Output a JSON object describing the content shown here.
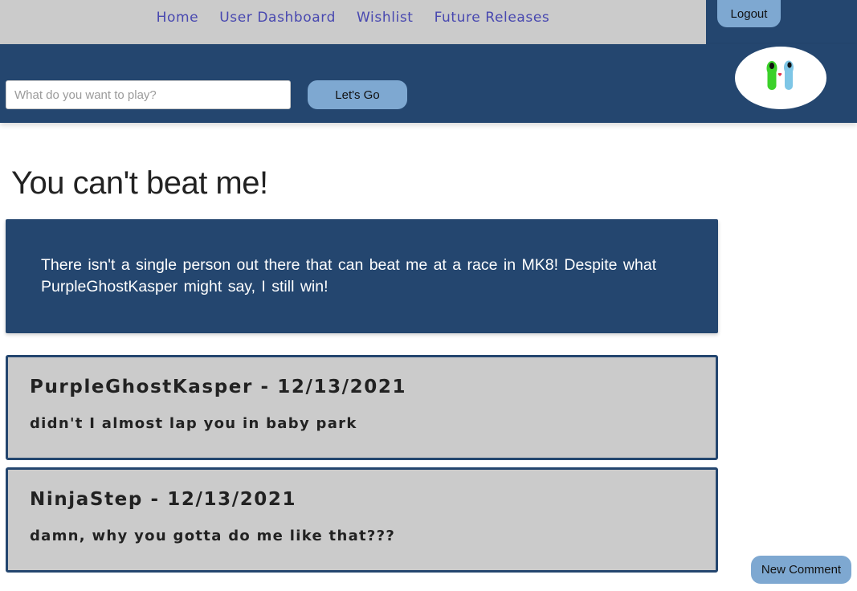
{
  "nav": {
    "items": [
      {
        "label": "Home"
      },
      {
        "label": "User Dashboard"
      },
      {
        "label": "Wishlist"
      },
      {
        "label": "Future Releases"
      }
    ],
    "logout_label": "Logout"
  },
  "search": {
    "placeholder": "What do you want to play?",
    "value": "",
    "button_label": "Let's Go"
  },
  "post": {
    "title": "You can't beat me!",
    "body": "There isn't a single person out there that can beat me at a race in MK8! Despite what PurpleGhostKasper might say, I still win!"
  },
  "comments": [
    {
      "header": "PurpleGhostKasper - 12/13/2021",
      "text": "didn't I almost lap you in baby park"
    },
    {
      "header": "NinjaStep - 12/13/2021",
      "text": "damn, why you gotta do me like that???"
    }
  ],
  "actions": {
    "new_comment_label": "New Comment"
  },
  "colors": {
    "brand_navy": "#24466f",
    "button_blue": "#7ea8d1",
    "nav_gray": "#cbcbcb",
    "nav_link": "#4848b0"
  },
  "icons": {
    "avatar": "alien-characters-avatar-icon"
  }
}
